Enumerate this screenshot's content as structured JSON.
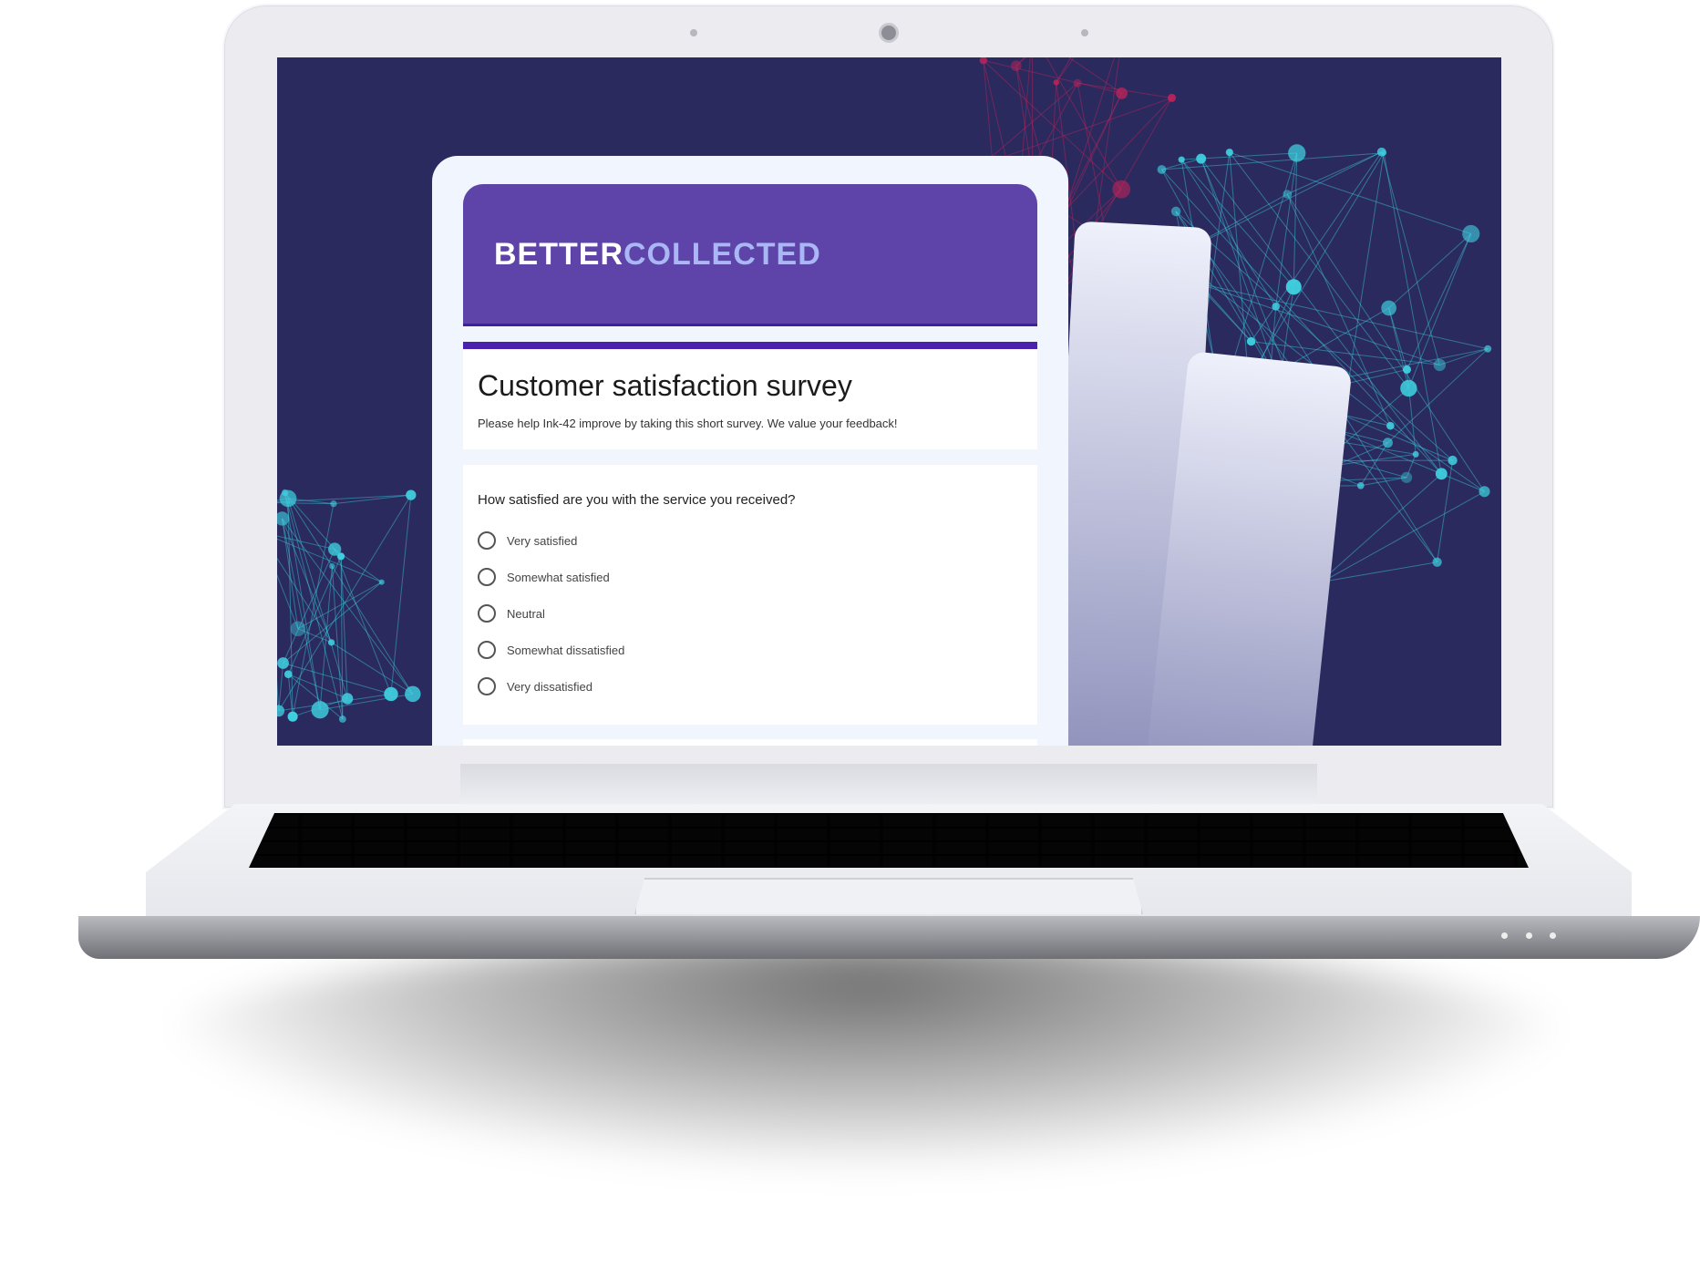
{
  "brand": {
    "part1": "BETTER",
    "part2": "COLLECTED"
  },
  "form": {
    "title": "Customer satisfaction survey",
    "description": "Please help Ink-42 improve by taking this short survey. We value your feedback!",
    "question": "How satisfied are you with the service you received?",
    "options": [
      "Very satisfied",
      "Somewhat satisfied",
      "Neutral",
      "Somewhat dissatisfied",
      "Very dissatisfied"
    ]
  },
  "colors": {
    "header": "#5e43a8",
    "accent": "#4a22ad",
    "background": "#2b2a5e",
    "logo_secondary": "#a9b8f5"
  }
}
